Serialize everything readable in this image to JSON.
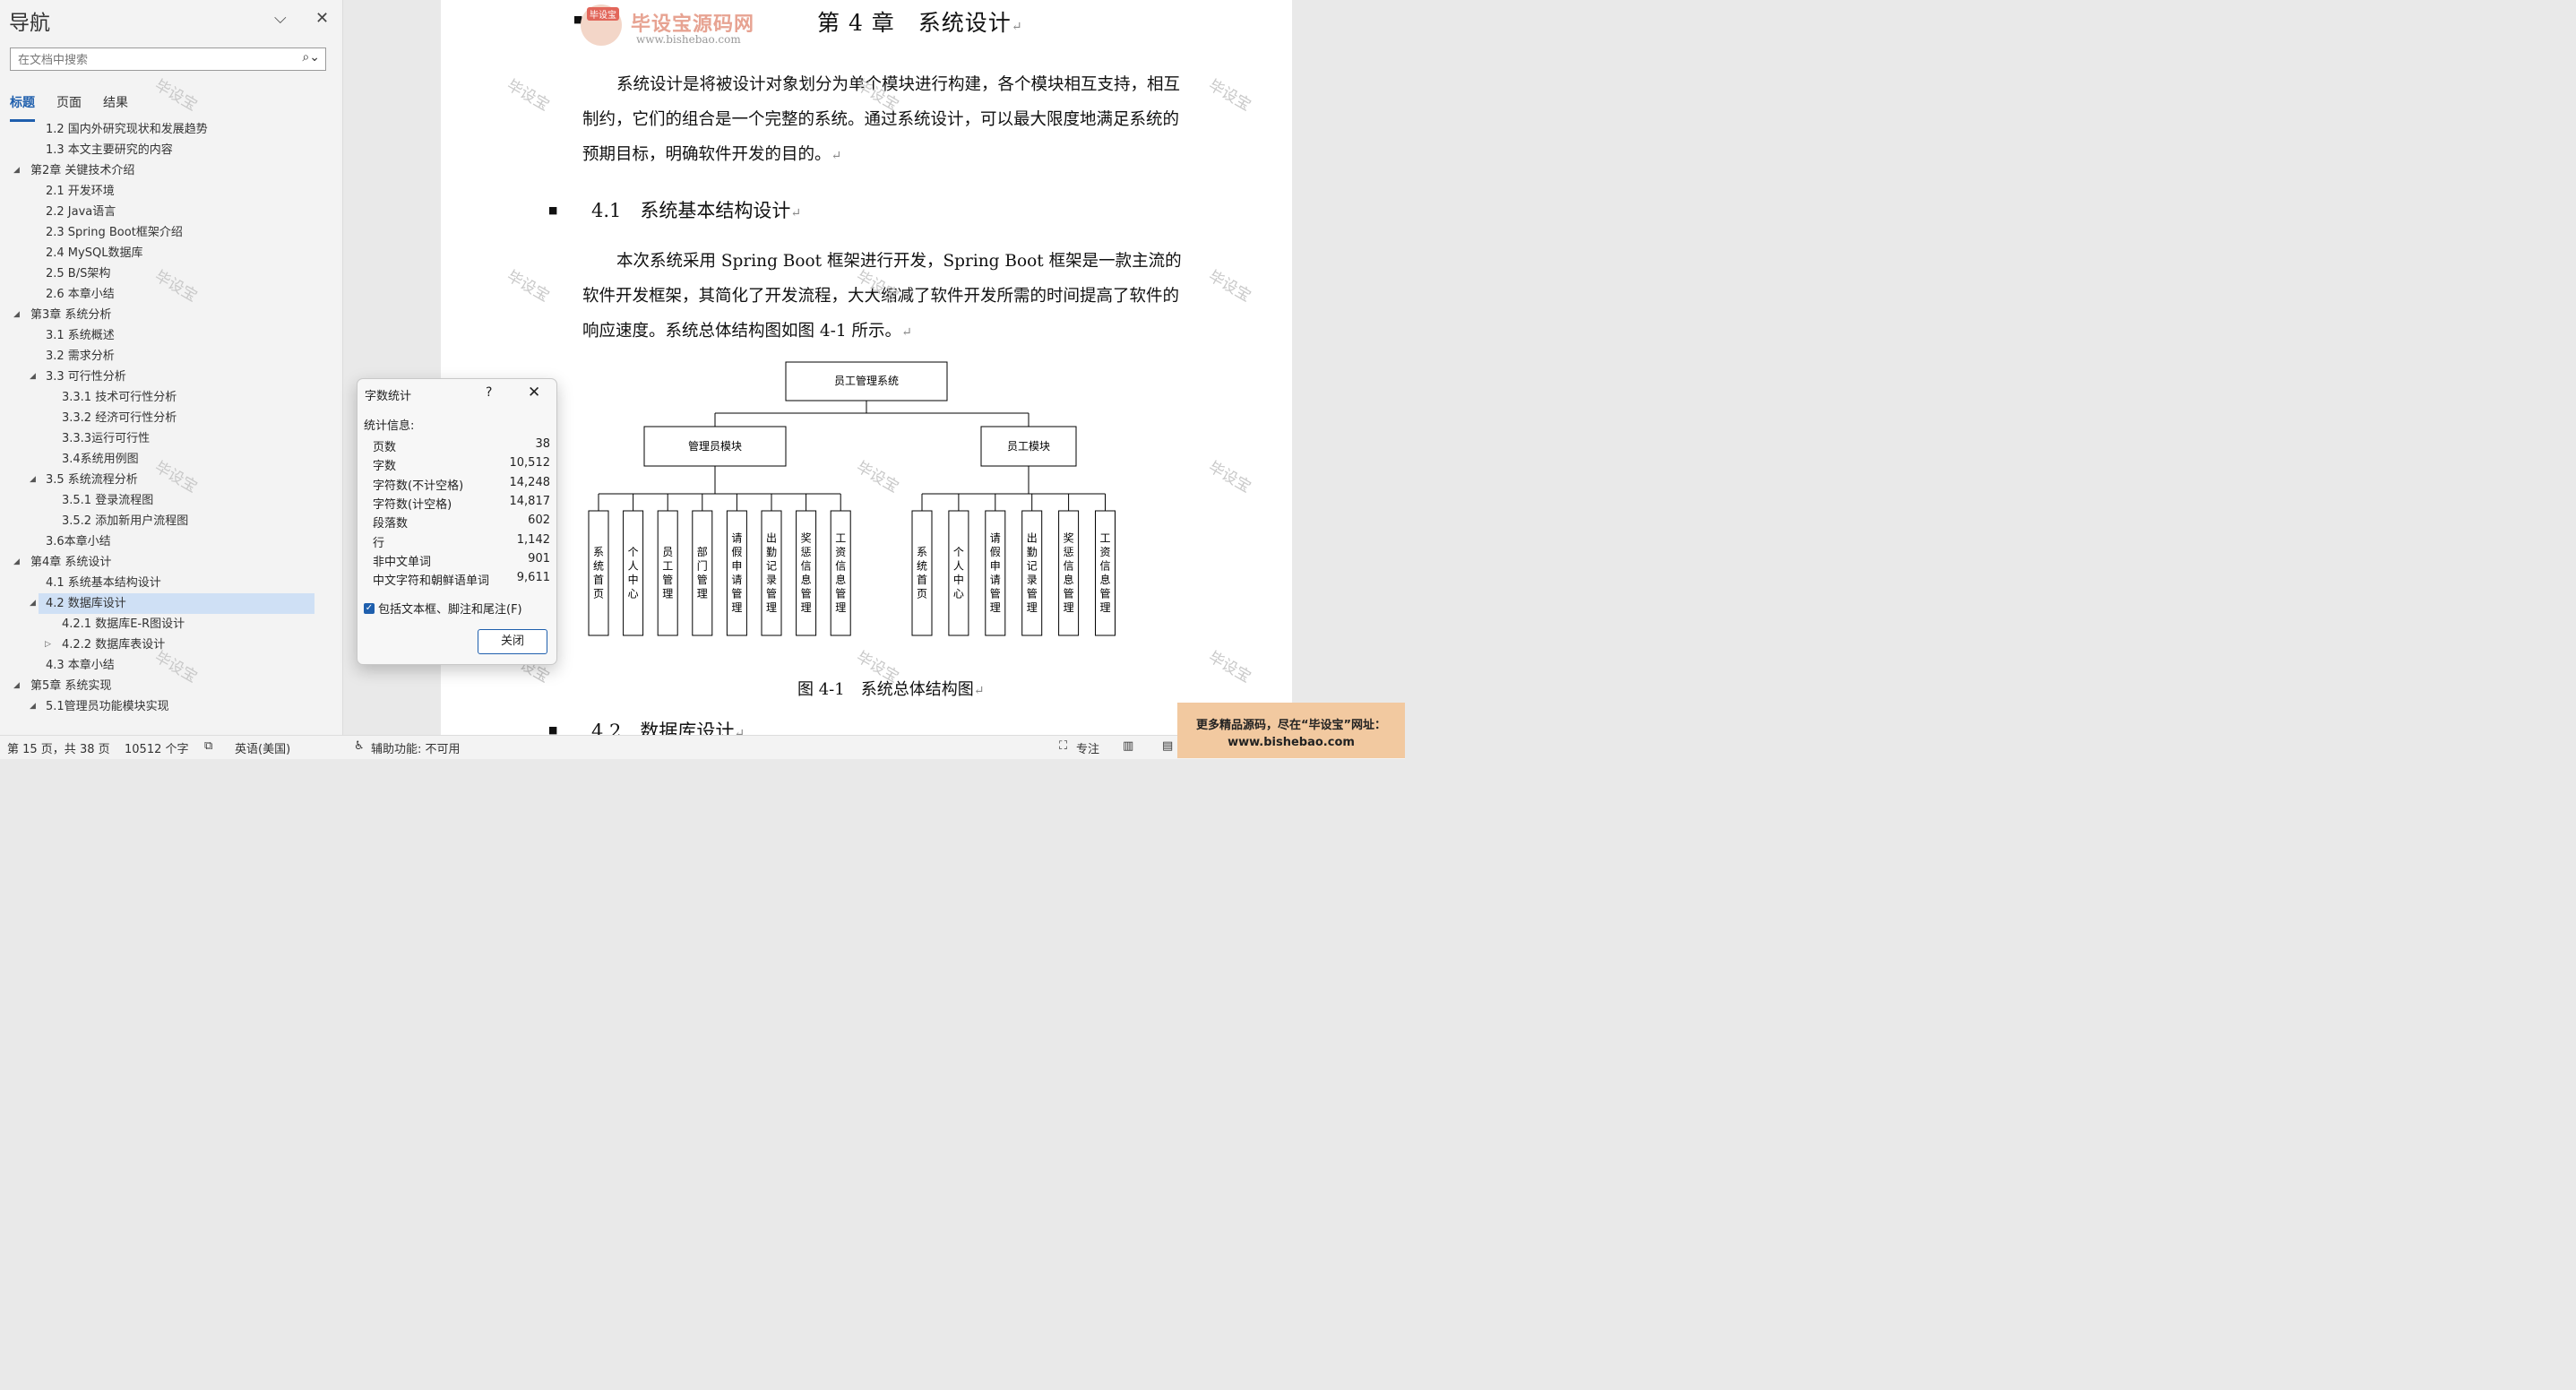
{
  "nav": {
    "title": "导航",
    "search_placeholder": "在文档中搜索",
    "tabs": [
      "标题",
      "页面",
      "结果"
    ],
    "items": [
      {
        "text": "1.2 国内外研究现状和发展趋势",
        "level": 2,
        "arrow": ""
      },
      {
        "text": "1.3 本文主要研究的内容",
        "level": 2,
        "arrow": ""
      },
      {
        "text": "第2章 关键技术介绍",
        "level": 1,
        "arrow": "◢"
      },
      {
        "text": "2.1 开发环境",
        "level": 2,
        "arrow": ""
      },
      {
        "text": "2.2 Java语言",
        "level": 2,
        "arrow": ""
      },
      {
        "text": "2.3 Spring Boot框架介绍",
        "level": 2,
        "arrow": ""
      },
      {
        "text": "2.4 MySQL数据库",
        "level": 2,
        "arrow": ""
      },
      {
        "text": "2.5 B/S架构",
        "level": 2,
        "arrow": ""
      },
      {
        "text": "2.6 本章小结",
        "level": 2,
        "arrow": ""
      },
      {
        "text": "第3章 系统分析",
        "level": 1,
        "arrow": "◢"
      },
      {
        "text": "3.1 系统概述",
        "level": 2,
        "arrow": ""
      },
      {
        "text": "3.2 需求分析",
        "level": 2,
        "arrow": ""
      },
      {
        "text": "3.3 可行性分析",
        "level": 2,
        "arrow": "◢"
      },
      {
        "text": "3.3.1 技术可行性分析",
        "level": 3,
        "arrow": ""
      },
      {
        "text": "3.3.2 经济可行性分析",
        "level": 3,
        "arrow": ""
      },
      {
        "text": "3.3.3运行可行性",
        "level": 3,
        "arrow": ""
      },
      {
        "text": "3.4系统用例图",
        "level": 3,
        "arrow": ""
      },
      {
        "text": "3.5 系统流程分析",
        "level": 2,
        "arrow": "◢"
      },
      {
        "text": "3.5.1 登录流程图",
        "level": 3,
        "arrow": ""
      },
      {
        "text": "3.5.2 添加新用户流程图",
        "level": 3,
        "arrow": ""
      },
      {
        "text": "3.6本章小结",
        "level": 2,
        "arrow": ""
      },
      {
        "text": "第4章 系统设计",
        "level": 1,
        "arrow": "◢"
      },
      {
        "text": "4.1 系统基本结构设计",
        "level": 2,
        "arrow": ""
      },
      {
        "text": "4.2 数据库设计",
        "level": 2,
        "arrow": "◢",
        "selected": true
      },
      {
        "text": "4.2.1 数据库E-R图设计",
        "level": 3,
        "arrow": ""
      },
      {
        "text": "4.2.2 数据库表设计",
        "level": 3,
        "arrow": "▷"
      },
      {
        "text": "4.3 本章小结",
        "level": 2,
        "arrow": ""
      },
      {
        "text": "第5章 系统实现",
        "level": 1,
        "arrow": "◢"
      },
      {
        "text": "5.1管理员功能模块实现",
        "level": 2,
        "arrow": "◢"
      }
    ]
  },
  "doc": {
    "chapter_title": "第 4 章　系统设计",
    "para1": "系统设计是将被设计对象划分为单个模块进行构建，各个模块相互支持，相互制约，它们的组合是一个完整的系统。通过系统设计，可以最大限度地满足系统的预期目标，明确软件开发的目的。",
    "heading_41": "4.1　系统基本结构设计",
    "para2": "本次系统采用 Spring Boot 框架进行开发，Spring Boot 框架是一款主流的软件开发框架，其简化了开发流程，大大缩减了软件开发所需的时间提高了软件的响应速度。系统总体结构图如图 4-1 所示。",
    "figure_caption": "图 4-1　系统总体结构图",
    "heading_42": "4.2　数据库设计",
    "return_mark": "↵"
  },
  "diagram": {
    "root": "员工管理系统",
    "modules": [
      {
        "label": "管理员模块",
        "children": [
          "系统首页",
          "个人中心",
          "员工管理",
          "部门管理",
          "请假申请管理",
          "出勤记录管理",
          "奖惩信息管理",
          "工资信息管理"
        ]
      },
      {
        "label": "员工模块",
        "children": [
          "系统首页",
          "个人中心",
          "请假申请管理",
          "出勤记录管理",
          "奖惩信息管理",
          "工资信息管理"
        ]
      }
    ]
  },
  "logo": {
    "badge": "毕设宝",
    "title": "毕设宝源码网",
    "url": "www.bishebao.com"
  },
  "watermark": "毕设宝",
  "dialog": {
    "title": "字数统计",
    "help": "?",
    "subtitle": "统计信息:",
    "stats": [
      {
        "label": "页数",
        "value": "38"
      },
      {
        "label": "字数",
        "value": "10,512"
      },
      {
        "label": "字符数(不计空格)",
        "value": "14,248"
      },
      {
        "label": "字符数(计空格)",
        "value": "14,817"
      },
      {
        "label": "段落数",
        "value": "602"
      },
      {
        "label": "行",
        "value": "1,142"
      },
      {
        "label": "非中文单词",
        "value": "901"
      },
      {
        "label": "中文字符和朝鲜语单词",
        "value": "9,611"
      }
    ],
    "checkbox_label": "包括文本框、脚注和尾注(F)",
    "checkbox_checked": true,
    "close_button": "关闭"
  },
  "status": {
    "page": "第 15 页，共 38 页",
    "words": "10512 个字",
    "language": "英语(美国)",
    "accessibility": "辅助功能: 不可用",
    "focus": "专注"
  },
  "banner": {
    "line1": "更多精品源码，尽在“毕设宝”网址：",
    "line2": "www.bishebao.com"
  }
}
